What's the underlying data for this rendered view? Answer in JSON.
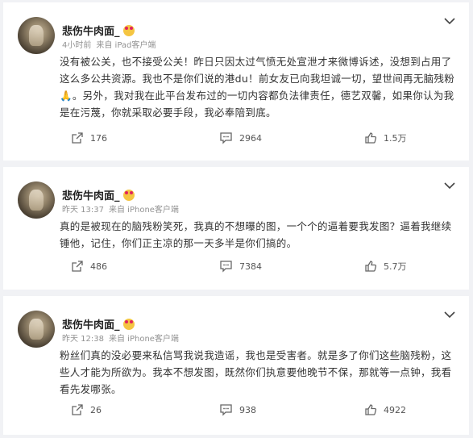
{
  "posts": [
    {
      "username": "悲伤牛肉面_",
      "time": "4小时前",
      "source": "来自 iPad客户端",
      "text": "没有被公关，也不接受公关！昨日只因太过气愤无处宣泄才来微博诉述，没想到占用了这么多公共资源。我也不是你们说的港du！前女友已向我坦诚一切，望世间再无脑残粉🙏。另外，我对我在此平台发布过的一切内容都负法律责任，德艺双馨，如果你认为我是在污蔑，你就采取必要手段，我必奉陪到底。",
      "shares": "176",
      "comments": "2964",
      "likes": "1.5万"
    },
    {
      "username": "悲伤牛肉面_",
      "time": "昨天 13:37",
      "source": "来自 iPhone客户端",
      "text": "真的是被现在的脑残粉笑死，我真的不想曝的图，一个个的逼着要我发图？逼着我继续锤他，记住，你们正主凉的那一天多半是你们搞的。",
      "shares": "486",
      "comments": "7384",
      "likes": "5.7万"
    },
    {
      "username": "悲伤牛肉面_",
      "time": "昨天 12:38",
      "source": "来自 iPhone客户端",
      "text": "粉丝们真的没必要来私信骂我说我造谣，我也是受害者。就是多了你们这些脑残粉，这些人才能为所欲为。我本不想发图，既然你们执意要他晚节不保，那就等一点钟，我看看先发哪张。",
      "shares": "26",
      "comments": "938",
      "likes": "4922"
    }
  ],
  "colors": {
    "accent": "#e0245e",
    "meta": "#939393",
    "background": "#f1f2f5"
  },
  "icons": {
    "share": "share-icon",
    "comment": "comment-icon",
    "like": "like-icon",
    "menu": "chevron-down-icon"
  }
}
